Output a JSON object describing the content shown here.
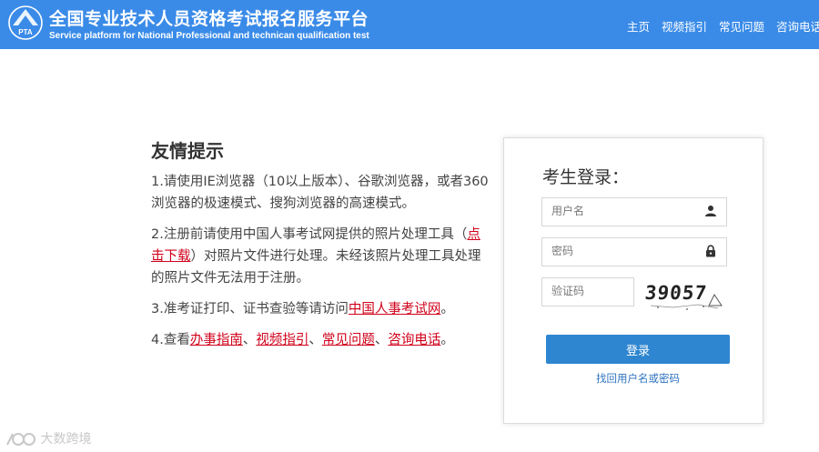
{
  "header": {
    "title": "全国专业技术人员资格考试报名服务平台",
    "subtitle": "Service platform for National Professional and technican qualification test",
    "logo_text": "PTA",
    "nav": [
      "主页",
      "视频指引",
      "常见问题",
      "咨询电话"
    ],
    "background_color": "#3a8be8"
  },
  "tips": {
    "title": "友情提示",
    "item1": "1.请使用IE浏览器（10以上版本）、谷歌浏览器，或者360浏览器的极速模式、搜狗浏览器的高速模式。",
    "item2_prefix": "2.注册前请使用中国人事考试网提供的照片处理工具（",
    "item2_link": "点击下载",
    "item2_suffix": "）对照片文件进行处理。未经该照片处理工具处理的照片文件无法用于注册。",
    "item3_prefix": "3.准考证打印、证书查验等请访问",
    "item3_link": "中国人事考试网",
    "item3_suffix": "。",
    "item4_prefix": "4.查看",
    "item4_links": [
      "办事指南",
      "视频指引",
      "常见问题",
      "咨询电话"
    ],
    "item4_separator": "、",
    "item4_suffix": "。",
    "link_color": "#d0021b"
  },
  "login": {
    "title": "考生登录：",
    "username_placeholder": "用户名",
    "password_placeholder": "密码",
    "captcha_placeholder": "验证码",
    "captcha_text": "39057",
    "login_button": "登录",
    "forgot_link": "找回用户名或密码",
    "button_color": "#2e86d0"
  },
  "watermark": {
    "text": "大数跨境"
  },
  "icons": {
    "username": "user-icon",
    "password": "lock-icon",
    "logo": "pta-logo-icon"
  }
}
